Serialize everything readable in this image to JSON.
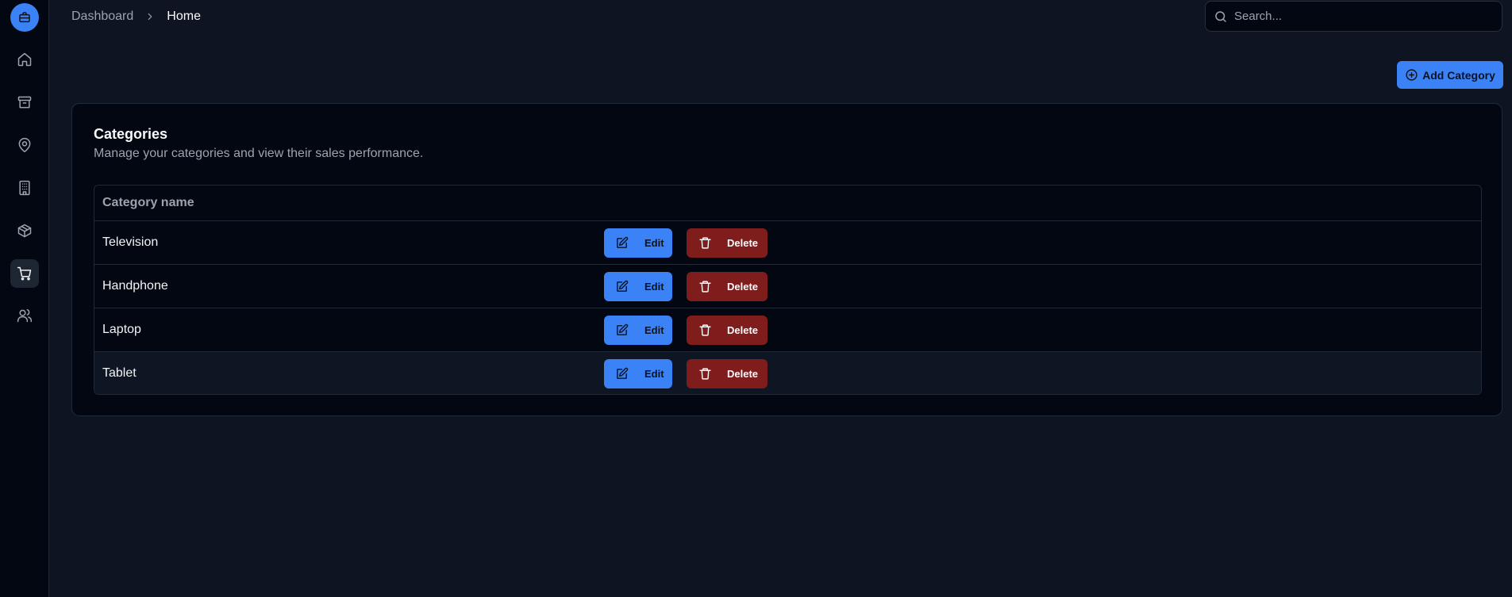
{
  "colors": {
    "background": "#0e1421",
    "sidebar": "#030712",
    "accent": "#3b82f6",
    "danger": "#7f1d1d"
  },
  "sidebar": {
    "logo_icon": "briefcase-icon",
    "items": [
      {
        "icon": "home-icon",
        "active": false
      },
      {
        "icon": "archive-icon",
        "active": false
      },
      {
        "icon": "map-pin-icon",
        "active": false
      },
      {
        "icon": "building-icon",
        "active": false
      },
      {
        "icon": "package-icon",
        "active": false
      },
      {
        "icon": "shopping-cart-icon",
        "active": true
      },
      {
        "icon": "users-icon",
        "active": false
      }
    ]
  },
  "header": {
    "breadcrumb": [
      "Dashboard",
      "Home"
    ],
    "search_placeholder": "Search..."
  },
  "toolbar": {
    "add_label": "Add Category"
  },
  "card": {
    "title": "Categories",
    "description": "Manage your categories and view their sales performance."
  },
  "table": {
    "header": "Category name",
    "edit_label": "Edit",
    "delete_label": "Delete",
    "rows": [
      {
        "name": "Television"
      },
      {
        "name": "Handphone"
      },
      {
        "name": "Laptop"
      },
      {
        "name": "Tablet"
      }
    ]
  }
}
